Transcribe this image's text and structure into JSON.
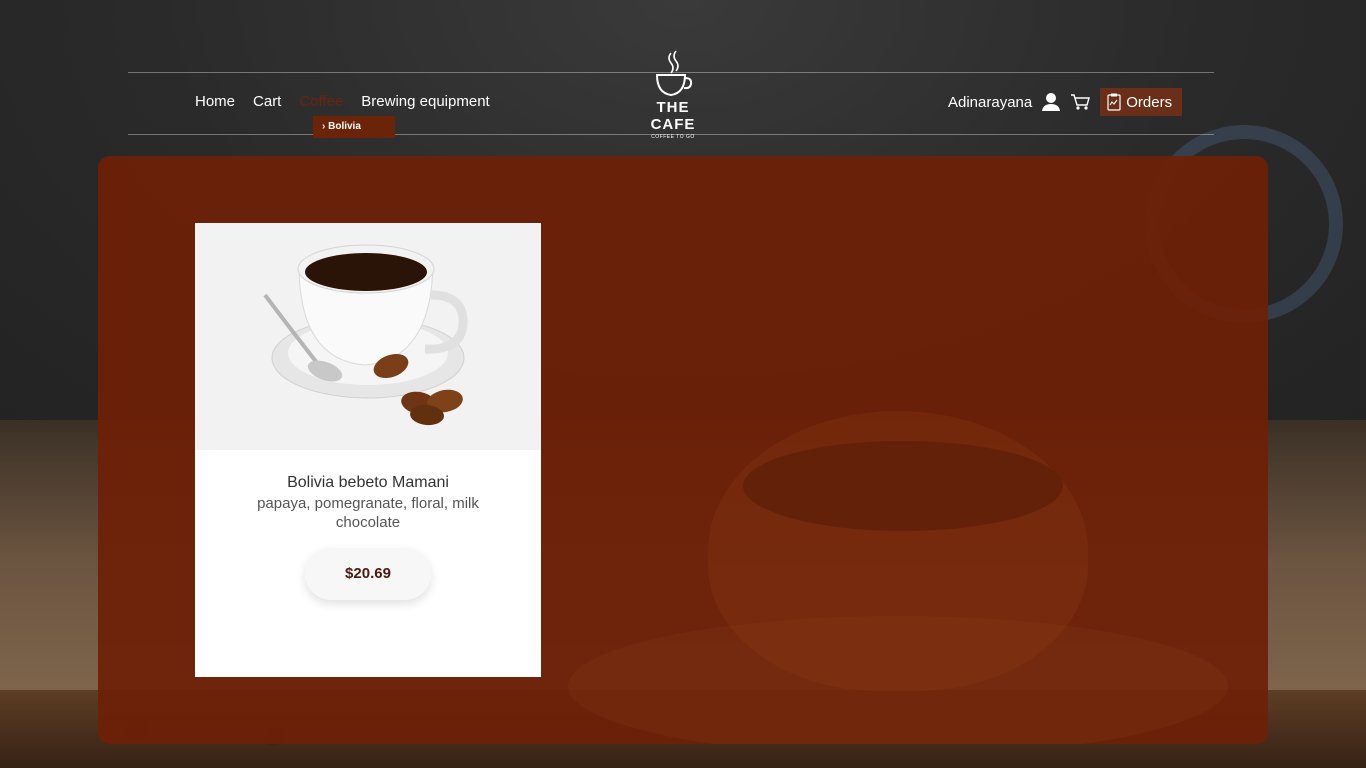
{
  "nav": {
    "items": [
      {
        "label": "Home"
      },
      {
        "label": "Cart"
      },
      {
        "label": "Coffee"
      },
      {
        "label": "Brewing equipment"
      }
    ],
    "dropdown_item": "› Bolivia"
  },
  "logo": {
    "title": "THE CAFE",
    "subtitle": "COFFEE TO GO"
  },
  "user": {
    "name": "Adinarayana",
    "orders_label": "Orders",
    "icons": [
      "user-icon",
      "cart-icon",
      "clipboard-icon"
    ]
  },
  "product": {
    "name": "Bolivia bebeto Mamani",
    "description": "papaya, pomegranate, floral, milk chocolate",
    "price": "$20.69"
  },
  "colors": {
    "panel": "#6e2006",
    "accent": "#6b2408",
    "price_text": "#4a1a10"
  }
}
